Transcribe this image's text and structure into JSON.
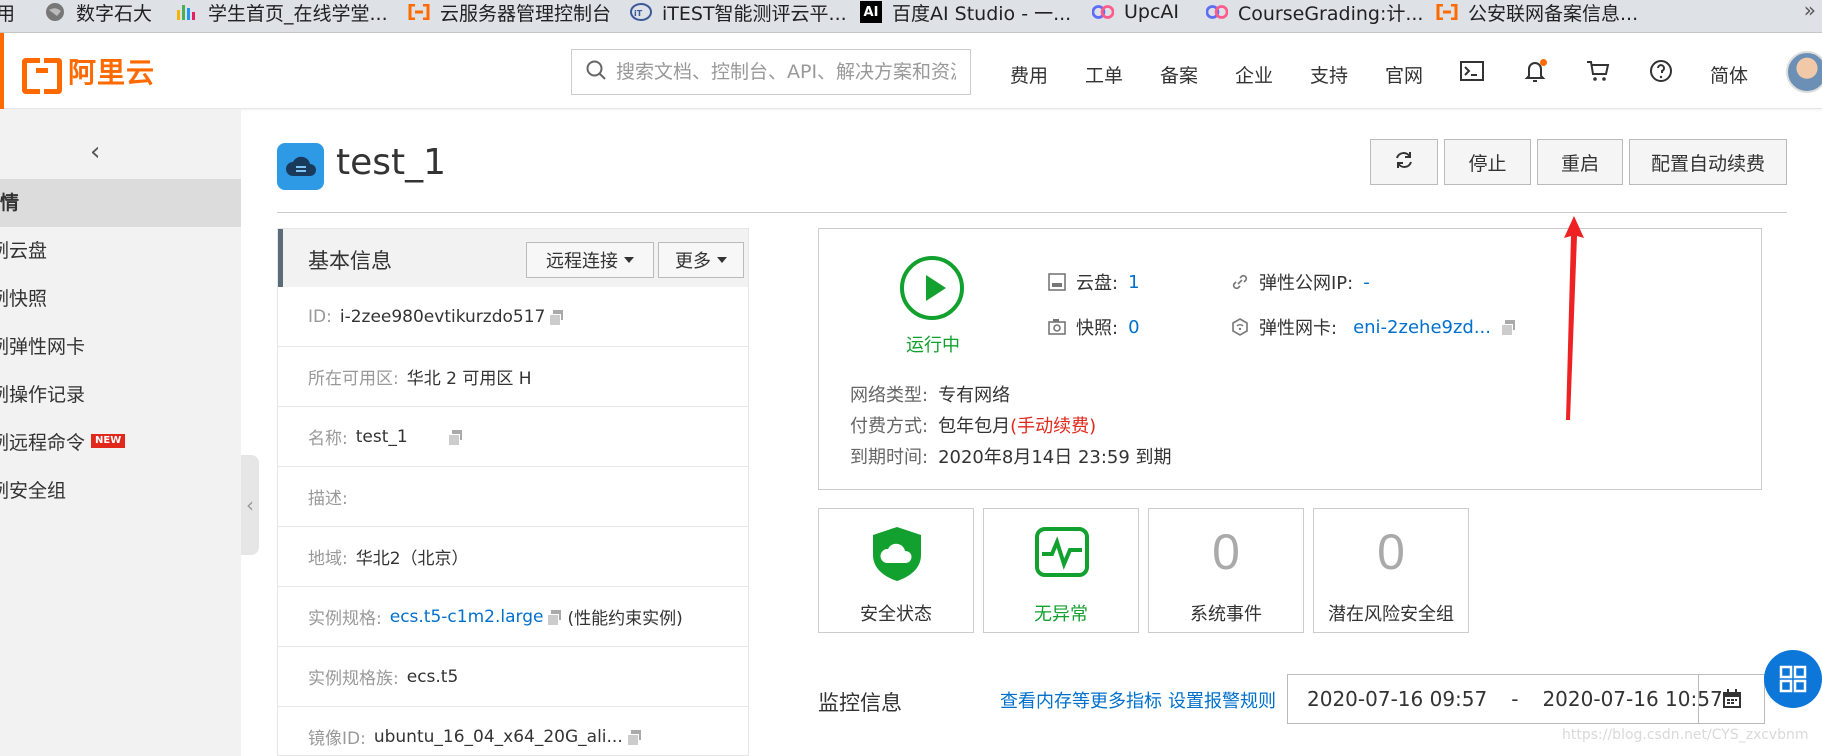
{
  "bookmarks": [
    {
      "label": "用",
      "icon": "apps-icon",
      "color": "#555555"
    },
    {
      "label": "数字石大",
      "icon": "globe-icon",
      "color": "#777777"
    },
    {
      "label": "学生首页_在线学堂...",
      "icon": "chart-bars-icon",
      "color": "#4caf50"
    },
    {
      "label": "云服务器管理控制台",
      "icon": "aliyun-icon",
      "color": "#ff6a00"
    },
    {
      "label": "iTEST智能测评云平...",
      "icon": "itest-icon",
      "color": "#3b5998"
    },
    {
      "label": "百度AI Studio - 一...",
      "icon": "ai-icon",
      "color": "#000000"
    },
    {
      "label": "UpcAI",
      "icon": "cg-icon",
      "color": "#5b6ef5"
    },
    {
      "label": "CourseGrading:计...",
      "icon": "cg-icon",
      "color": "#5b6ef5"
    },
    {
      "label": "公安联网备案信息...",
      "icon": "aliyun-icon",
      "color": "#ff6a00"
    }
  ],
  "bookmarks_more": "»",
  "header": {
    "logo_text": "阿里云",
    "search_placeholder": "搜索文档、控制台、API、解决方案和资源",
    "nav": [
      "费用",
      "工单",
      "备案",
      "企业",
      "支持",
      "官网"
    ],
    "lang": "简体",
    "accent_color": "#ff6a00"
  },
  "sidebar": {
    "collapse": "‹",
    "items": [
      {
        "label": "详情",
        "active": true
      },
      {
        "label": "例云盘",
        "active": false
      },
      {
        "label": "例快照",
        "active": false
      },
      {
        "label": "例弹性网卡",
        "active": false
      },
      {
        "label": "例操作记录",
        "active": false
      },
      {
        "label": "例远程命令",
        "active": false,
        "badge": "NEW"
      },
      {
        "label": "例安全组",
        "active": false
      }
    ],
    "toggle": "‹"
  },
  "instance": {
    "title": "test_1",
    "buttons": {
      "stop": "停止",
      "restart": "重启",
      "auto_renew": "配置自动续费"
    }
  },
  "basic_info": {
    "title": "基本信息",
    "remote_connect": "远程连接",
    "more": "更多",
    "rows": [
      {
        "key": "ID:",
        "value": "i-2zee980evtikurzdo517",
        "copy": true
      },
      {
        "key": "所在可用区:",
        "value": "华北 2 可用区 H"
      },
      {
        "key": "名称:",
        "value": "test_1",
        "copy": true
      },
      {
        "key": "描述:",
        "value": ""
      },
      {
        "key": "地域:",
        "value": "华北2（北京）"
      },
      {
        "key": "实例规格:",
        "value": "ecs.t5-c1m2.large",
        "link": true,
        "copy": true,
        "extra": "(性能约束实例)"
      },
      {
        "key": "实例规格族:",
        "value": "ecs.t5"
      },
      {
        "key": "镜像ID:",
        "value": "ubuntu_16_04_x64_20G_ali...",
        "copy": true
      }
    ]
  },
  "status": {
    "running": "运行中",
    "disk_label": "云盘:",
    "disk_value": "1",
    "snapshot_label": "快照:",
    "snapshot_value": "0",
    "eip_label": "弹性公网IP:",
    "eip_value": "-",
    "eni_label": "弹性网卡:",
    "eni_value": "eni-2zehe9zd...",
    "network_label": "网络类型:",
    "network_value": "专有网络",
    "billing_label": "付费方式:",
    "billing_value": "包年包月",
    "billing_note": "(手动续费)",
    "expire_label": "到期时间:",
    "expire_value": "2020年8月14日 23:59 到期",
    "ok_color": "#12a12e"
  },
  "cards": [
    {
      "label": "安全状态",
      "kind": "shield"
    },
    {
      "label": "无异常",
      "kind": "pulse"
    },
    {
      "label": "系统事件",
      "num": "0"
    },
    {
      "label": "潜在风险安全组",
      "num": "0"
    }
  ],
  "monitor": {
    "title": "监控信息",
    "link_more": "查看内存等更多指标",
    "link_alarm": "设置报警规则",
    "date_start": "2020-07-16 09:57",
    "date_sep": "-",
    "date_end": "2020-07-16 10:57"
  },
  "watermark": "https://blog.csdn.net/CYS_zxcvbnm"
}
